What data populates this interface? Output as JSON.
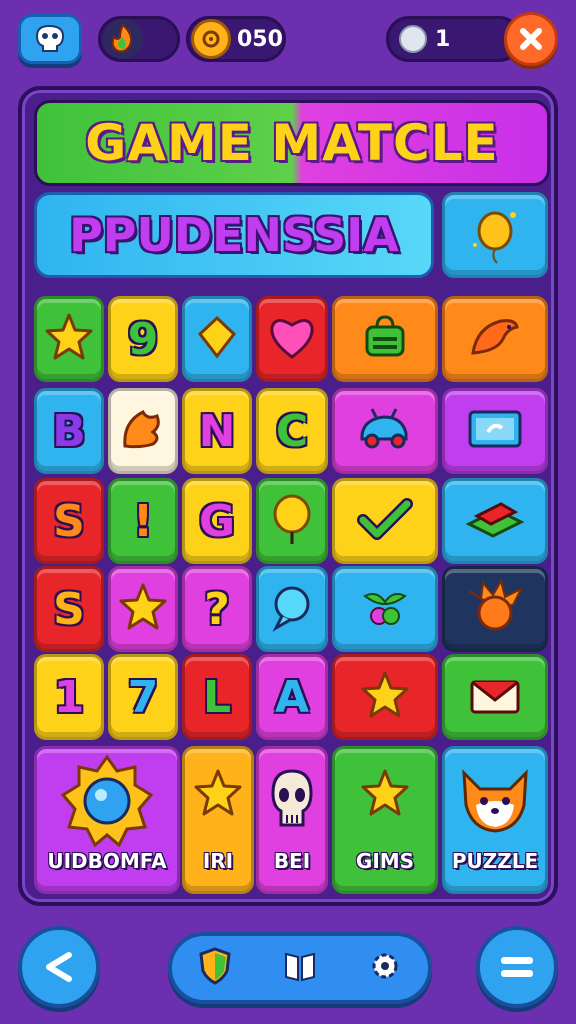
{
  "header": {
    "energy_icon": "flame-icon",
    "coins_value": "050",
    "gems_value": "1",
    "colors": {
      "pill": "#3a1770",
      "close": "#ff6a2a",
      "button": "#2fa3f0"
    }
  },
  "board": {
    "title": "GAME MATCLE",
    "subtitle": "PPUDENSSIA",
    "grid": {
      "rows": [
        [
          {
            "kind": "icon",
            "icon": "star-icon",
            "color": "#3fc23a"
          },
          {
            "kind": "letter",
            "text": "9",
            "color": "#ffd21a",
            "ink": "#3fc23a"
          },
          {
            "kind": "icon",
            "icon": "gem-icon",
            "color": "#2fb4f0"
          },
          {
            "kind": "icon",
            "icon": "heart-icon",
            "color": "#e8262a"
          },
          {
            "kind": "icon",
            "icon": "bag-icon",
            "color": "#ff8a1a"
          },
          {
            "kind": "icon",
            "icon": "fish-icon",
            "color": "#ff8a1a"
          }
        ],
        [
          {
            "kind": "letter",
            "text": "B",
            "color": "#2fb4f0",
            "ink": "#8a3ae8"
          },
          {
            "kind": "icon",
            "icon": "leaf-icon",
            "color": "#fff6e0"
          },
          {
            "kind": "letter",
            "text": "N",
            "color": "#ffd21a",
            "ink": "#e040e0"
          },
          {
            "kind": "letter",
            "text": "C",
            "color": "#ffd21a",
            "ink": "#3fc23a"
          },
          {
            "kind": "icon",
            "icon": "car-icon",
            "color": "#e040e0"
          },
          {
            "kind": "icon",
            "icon": "card-icon",
            "color": "#c13ef0"
          }
        ],
        [
          {
            "kind": "letter",
            "text": "S",
            "color": "#e8262a",
            "ink": "#ff8a1a"
          },
          {
            "kind": "letter",
            "text": "!",
            "color": "#3fc23a",
            "ink": "#ff8a1a"
          },
          {
            "kind": "letter",
            "text": "G",
            "color": "#ffd21a",
            "ink": "#e040e0"
          },
          {
            "kind": "icon",
            "icon": "balloon-icon",
            "color": "#3fc23a"
          },
          {
            "kind": "icon",
            "icon": "check-icon",
            "color": "#ffd21a"
          },
          {
            "kind": "icon",
            "icon": "books-icon",
            "color": "#2fb4f0"
          }
        ],
        [
          {
            "kind": "letter",
            "text": "S",
            "color": "#e8262a",
            "ink": "#ffb21a"
          },
          {
            "kind": "icon",
            "icon": "star-icon",
            "color": "#e040e0"
          },
          {
            "kind": "letter",
            "text": "?",
            "color": "#e040e0",
            "ink": "#ffd21a"
          },
          {
            "kind": "icon",
            "icon": "chat-icon",
            "color": "#2fb4f0"
          },
          {
            "kind": "icon",
            "icon": "berries-icon",
            "color": "#2fb4f0"
          },
          {
            "kind": "icon",
            "icon": "fire-orb-icon",
            "color": "#1f3560"
          }
        ],
        [
          {
            "kind": "letter",
            "text": "1",
            "color": "#ffd21a",
            "ink": "#e040e0"
          },
          {
            "kind": "letter",
            "text": "7",
            "color": "#ffd21a",
            "ink": "#2fb4f0"
          },
          {
            "kind": "letter",
            "text": "L",
            "color": "#e8262a",
            "ink": "#3fc23a"
          },
          {
            "kind": "letter",
            "text": "A",
            "color": "#e040e0",
            "ink": "#2fb4f0"
          },
          {
            "kind": "icon",
            "icon": "star-icon",
            "color": "#e8262a"
          },
          {
            "kind": "icon",
            "icon": "mail-icon",
            "color": "#3fc23a"
          }
        ]
      ]
    },
    "cards": [
      {
        "label": "UIDBOMFA",
        "icon": "orb-badge-icon",
        "color": "#c13ef0"
      },
      {
        "label": "IRI",
        "icon": "star-icon",
        "color": "#ffb21a"
      },
      {
        "label": "BEI",
        "icon": "skull-icon",
        "color": "#e040e0"
      },
      {
        "label": "GIMS",
        "icon": "star-icon",
        "color": "#3fc23a"
      },
      {
        "label": "PUZZLE",
        "icon": "fox-icon",
        "color": "#2fb4f0"
      }
    ]
  },
  "footer": {
    "left_icon": "share-icon",
    "center_icons": [
      "shield-icon",
      "book-icon",
      "gear-icon"
    ],
    "right_icon": "menu-icon"
  }
}
